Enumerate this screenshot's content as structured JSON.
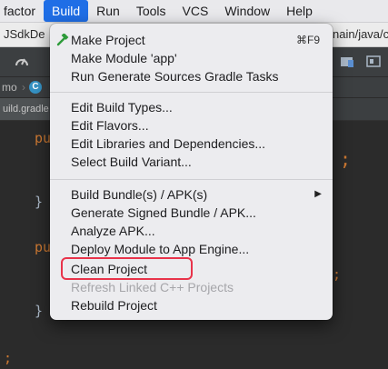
{
  "menubar": {
    "items": [
      {
        "label": "factor"
      },
      {
        "label": "Build",
        "active": true
      },
      {
        "label": "Run"
      },
      {
        "label": "Tools"
      },
      {
        "label": "VCS"
      },
      {
        "label": "Window"
      },
      {
        "label": "Help"
      }
    ]
  },
  "pathbar": {
    "left_text": "JSdkDe",
    "right_text": "nain/java/c"
  },
  "navbar": {
    "module_text": "mo",
    "class_badge": "C"
  },
  "editor": {
    "tab_label": "uild.gradle",
    "fragments": [
      "pu",
      "}",
      "pu",
      "}",
      ";",
      ";",
      ";"
    ]
  },
  "build_menu": {
    "make_project": {
      "label": "Make Project",
      "shortcut": "⌘F9",
      "icon": "hammer-icon"
    },
    "make_module": {
      "label": "Make Module 'app'"
    },
    "run_generate": {
      "label": "Run Generate Sources Gradle Tasks"
    },
    "edit_build_types": {
      "label": "Edit Build Types..."
    },
    "edit_flavors": {
      "label": "Edit Flavors..."
    },
    "edit_libraries": {
      "label": "Edit Libraries and Dependencies..."
    },
    "select_variant": {
      "label": "Select Build Variant..."
    },
    "build_bundle": {
      "label": "Build Bundle(s) / APK(s)",
      "submenu_arrow": "▶"
    },
    "generate_signed": {
      "label": "Generate Signed Bundle / APK..."
    },
    "analyze_apk": {
      "label": "Analyze APK..."
    },
    "deploy_module": {
      "label": "Deploy Module to App Engine..."
    },
    "clean_project": {
      "label": "Clean Project",
      "highlighted": true
    },
    "refresh_linked": {
      "label": "Refresh Linked C++ Projects",
      "disabled": true
    },
    "rebuild_project": {
      "label": "Rebuild Project"
    }
  },
  "colors": {
    "active_menu": "#1f6ee6",
    "highlight_border": "#e8334a",
    "keyword": "#cc7832"
  }
}
